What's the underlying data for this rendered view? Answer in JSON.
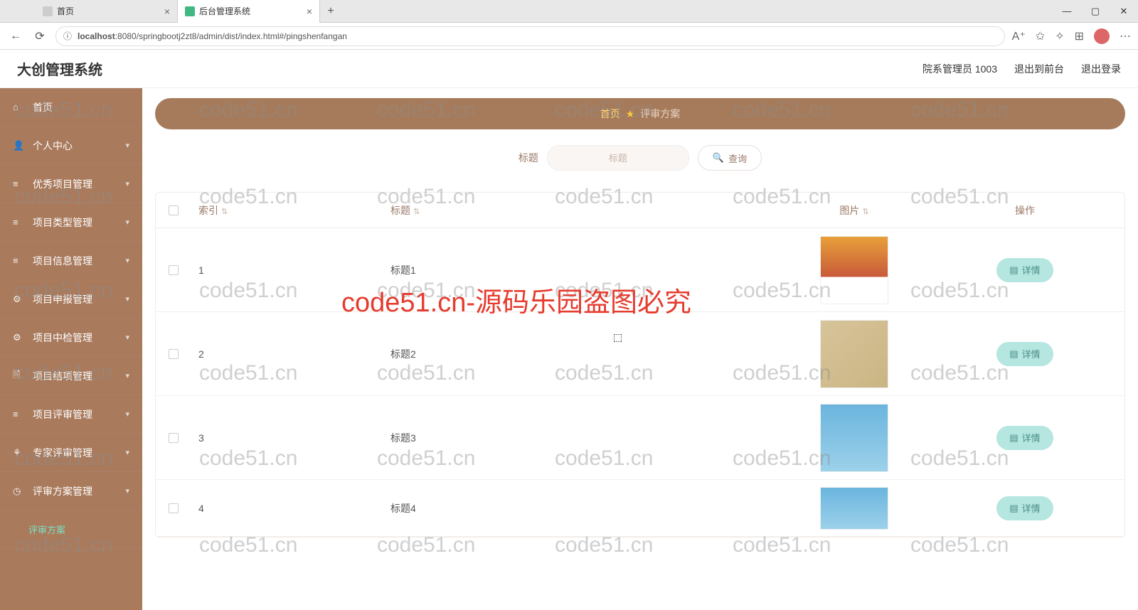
{
  "browser": {
    "tab1": "首页",
    "tab2": "后台管理系统",
    "url_host": "localhost",
    "url_rest": ":8080/springbootj2zt8/admin/dist/index.html#/pingshenfangan"
  },
  "header": {
    "app_title": "大创管理系统",
    "user": "院系管理员 1003",
    "front": "退出到前台",
    "logout": "退出登录"
  },
  "sidebar": {
    "items": [
      "首页",
      "个人中心",
      "优秀项目管理",
      "项目类型管理",
      "项目信息管理",
      "项目申报管理",
      "项目中检管理",
      "项目结项管理",
      "项目评审管理",
      "专家评审管理",
      "评审方案管理"
    ],
    "sub_active": "评审方案"
  },
  "breadcrumb": {
    "home": "首页",
    "current": "评审方案"
  },
  "search": {
    "label": "标题",
    "placeholder": "标题",
    "button": "查询"
  },
  "table": {
    "headers": {
      "index": "索引",
      "title": "标题",
      "image": "图片",
      "op": "操作"
    },
    "detail": "详情",
    "rows": [
      {
        "index": "1",
        "title": "标题1"
      },
      {
        "index": "2",
        "title": "标题2"
      },
      {
        "index": "3",
        "title": "标题3"
      },
      {
        "index": "4",
        "title": "标题4"
      }
    ]
  },
  "watermark": {
    "grey": "code51.cn",
    "red": "code51.cn-源码乐园盗图必究"
  }
}
